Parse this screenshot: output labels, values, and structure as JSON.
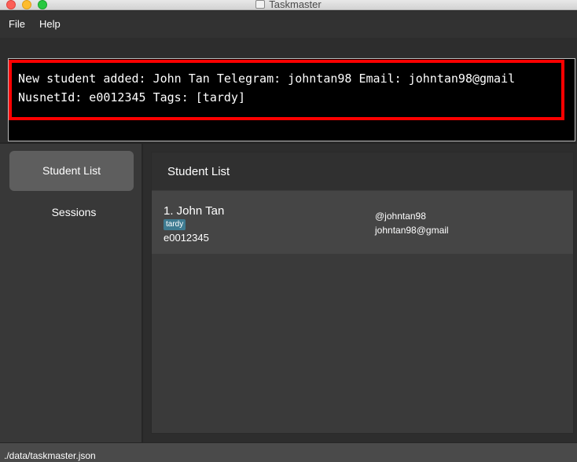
{
  "window": {
    "title": "Taskmaster",
    "controls": [
      "close",
      "minimize",
      "maximize"
    ]
  },
  "menu": {
    "file": "File",
    "help": "Help"
  },
  "result_display": {
    "line1": "New student added: John Tan Telegram: johntan98 Email: johntan98@gmail",
    "line2": "NusnetId: e0012345 Tags: [tardy]",
    "highlight_color": "#ff0000"
  },
  "sidebar": {
    "items": [
      {
        "label": "Student List",
        "active": true
      },
      {
        "label": "Sessions",
        "active": false
      }
    ]
  },
  "panel": {
    "title": "Student List",
    "students": [
      {
        "name": "1.  John Tan",
        "tag": "tardy",
        "nusnet": "e0012345",
        "telegram": "@johntan98",
        "email": "johntan98@gmail"
      }
    ]
  },
  "status_bar": {
    "path": "./data/taskmaster.json"
  },
  "colors": {
    "tag_bg": "#3e7b91",
    "active_item_bg": "#5e5e5e",
    "background": "#2d2d2d"
  }
}
